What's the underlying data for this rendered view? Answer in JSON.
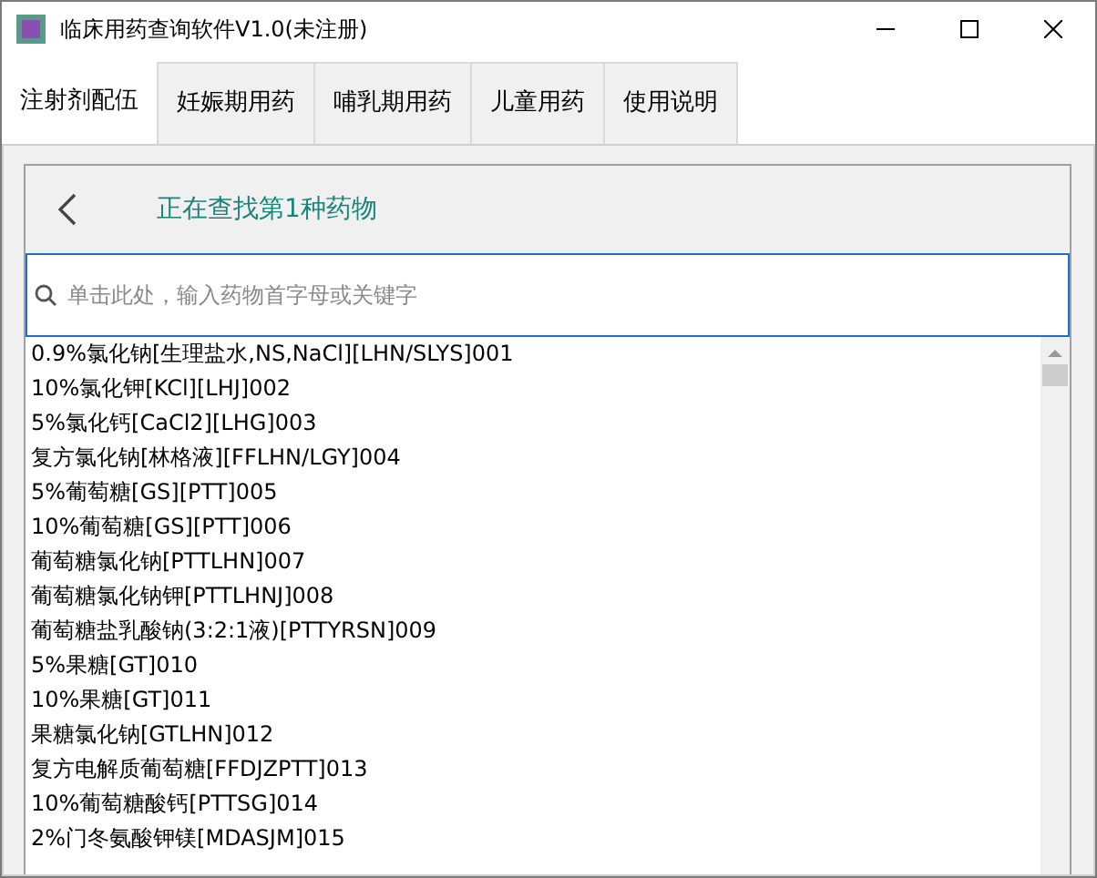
{
  "window": {
    "title": "临床用药查询软件V1.0(未注册)"
  },
  "tabs": [
    {
      "label": "注射剂配伍",
      "selected": true
    },
    {
      "label": "妊娠期用药",
      "selected": false
    },
    {
      "label": "哺乳期用药",
      "selected": false
    },
    {
      "label": "儿童用药",
      "selected": false
    },
    {
      "label": "使用说明",
      "selected": false
    }
  ],
  "header": {
    "title": "正在查找第1种药物"
  },
  "search": {
    "placeholder": "单击此处，输入药物首字母或关键字"
  },
  "list": [
    "0.9%氯化钠[生理盐水,NS,NaCl][LHN/SLYS]001",
    "10%氯化钾[KCl][LHJ]002",
    "5%氯化钙[CaCl2][LHG]003",
    "复方氯化钠[林格液][FFLHN/LGY]004",
    "5%葡萄糖[GS][PTT]005",
    "10%葡萄糖[GS][PTT]006",
    "葡萄糖氯化钠[PTTLHN]007",
    "葡萄糖氯化钠钾[PTTLHNJ]008",
    "葡萄糖盐乳酸钠(3:2:1液)[PTTYRSN]009",
    "5%果糖[GT]010",
    "10%果糖[GT]011",
    "果糖氯化钠[GTLHN]012",
    "复方电解质葡萄糖[FFDJZPTT]013",
    "10%葡萄糖酸钙[PTTSG]014",
    "2%门冬氨酸钾镁[MDASJM]015"
  ]
}
